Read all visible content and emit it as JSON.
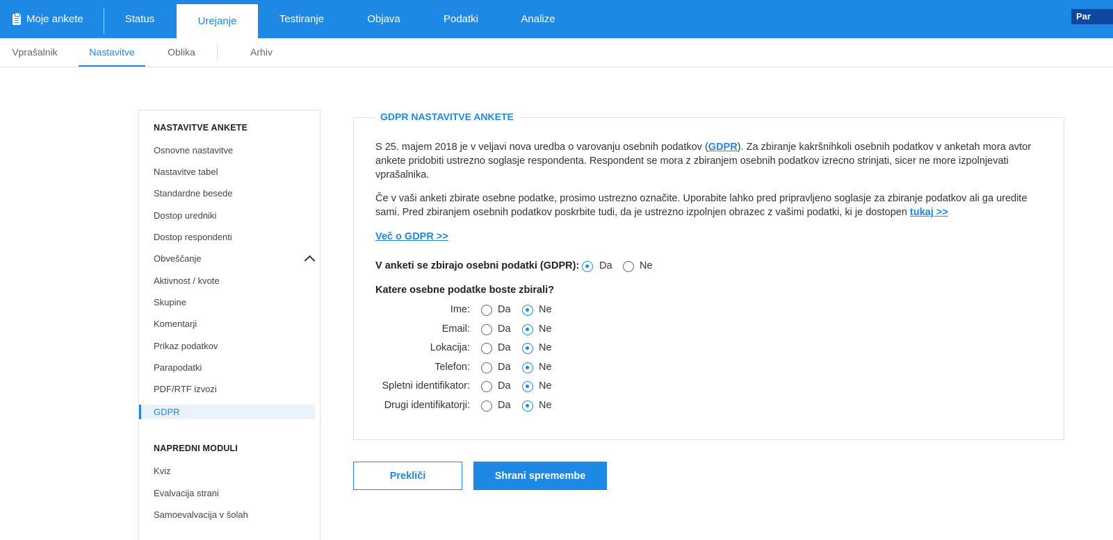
{
  "topbar": {
    "logo_label": "Moje ankete",
    "tabs": [
      "Status",
      "Urejanje",
      "Testiranje",
      "Objava",
      "Podatki",
      "Analize"
    ],
    "user": "Par"
  },
  "subnav": {
    "items": [
      "Vprašalnik",
      "Nastavitve",
      "Oblika",
      "Arhiv"
    ]
  },
  "sidebar": {
    "heading1": "NASTAVITVE ANKETE",
    "items": [
      "Osnovne nastavitve",
      "Nastavitve tabel",
      "Standardne besede",
      "Dostop uredniki",
      "Dostop respondenti",
      "Obveščanje",
      "Aktivnost / kvote",
      "Skupine",
      "Komentarji",
      "Prikaz podatkov",
      "Parapodatki",
      "PDF/RTF izvozi",
      "GDPR"
    ],
    "heading2": "NAPREDNI MODULI",
    "modules": [
      "Kviz",
      "Evalvacija strani",
      "Samoevalvacija v šolah"
    ]
  },
  "main": {
    "title": "GDPR NASTAVITVE ANKETE",
    "p1_before": "S 25. majem 2018 je v veljavi nova uredba o varovanju osebnih podatkov (",
    "p1_link": "GDPR",
    "p1_after": "). Za zbiranje kakršnihkoli osebnih podatkov v anketah mora avtor ankete pridobiti ustrezno soglasje respondenta. Respondent se mora z zbiranjem osebnih podatkov izrecno strinjati, sicer ne more izpolnjevati vprašalnika.",
    "p2_before": "Če v vaši anketi zbirate osebne podatke, prosimo ustrezno označite. Uporabite lahko pred pripravljeno soglasje za zbiranje podatkov ali ga uredite sami. Pred zbiranjem osebnih podatkov poskrbite tudi, da je ustrezno izpolnjen obrazec z vašimi podatki, ki je dostopen ",
    "p2_link": "tukaj >>",
    "more_link": "Več o GDPR >>",
    "question_main": "V anketi se zbirajo osebni podatki (GDPR):",
    "question_main_value": "Da",
    "yes": "Da",
    "no": "Ne",
    "question_sub": "Katere osebne podatke boste zbirali?",
    "fields": [
      {
        "label": "Ime:",
        "value": "Ne"
      },
      {
        "label": "Email:",
        "value": "Ne"
      },
      {
        "label": "Lokacija:",
        "value": "Ne"
      },
      {
        "label": "Telefon:",
        "value": "Ne"
      },
      {
        "label": "Spletni identifikator:",
        "value": "Ne"
      },
      {
        "label": "Drugi identifikatorji:",
        "value": "Ne"
      }
    ]
  },
  "buttons": {
    "cancel": "Prekliči",
    "save": "Shrani spremembe"
  },
  "colors": {
    "primary": "#1e88e5",
    "active_bg": "#eaf3fd"
  }
}
